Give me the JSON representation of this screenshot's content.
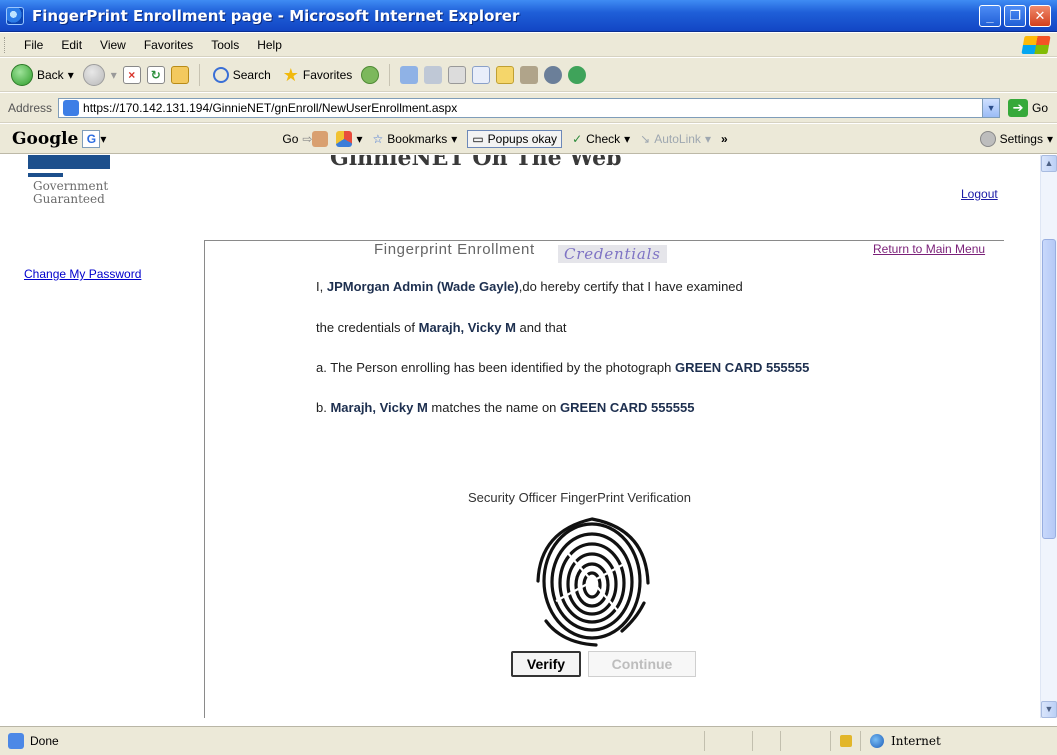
{
  "window": {
    "title": "FingerPrint Enrollment page - Microsoft Internet Explorer"
  },
  "menu": [
    "File",
    "Edit",
    "View",
    "Favorites",
    "Tools",
    "Help"
  ],
  "toolbar": {
    "back_label": "Back",
    "search_label": "Search",
    "favorites_label": "Favorites"
  },
  "address": {
    "label": "Address",
    "url": "https://170.142.131.194/GinnieNET/gnEnroll/NewUserEnrollment.aspx",
    "go_label": "Go"
  },
  "google_toolbar": {
    "logo": "Google",
    "g_button": "G",
    "go_label": "Go",
    "bookmarks_label": "Bookmarks",
    "popups_label": "Popups okay",
    "check_label": "Check",
    "autolink_label": "AutoLink",
    "more_label": "»",
    "settings_label": "Settings"
  },
  "page": {
    "header_text": "GinnieNET On The Web",
    "gov_line1": "Government",
    "gov_line2": "Guaranteed",
    "enroll_title": "Fingerprint Enrollment",
    "logout": "Logout",
    "return_link": "Return to Main Menu",
    "change_password": "Change My Password",
    "credentials_heading": "Credentials",
    "line1_pre": "I, ",
    "line1_name": "JPMorgan Admin (Wade Gayle)",
    "line1_post": ",do hereby certify that I have examined",
    "line2_pre": "the credentials of ",
    "line2_name": "Marajh, Vicky M",
    "line2_post": " and that",
    "line3_pre": "a. The Person enrolling has been identified by the photograph ",
    "line3_doc": "GREEN CARD 555555",
    "line4_pre": "b. ",
    "line4_name": "Marajh, Vicky M",
    "line4_mid": " matches the name on ",
    "line4_doc": "GREEN CARD 555555",
    "security_label": "Security Officer FingerPrint Verification",
    "verify_button": "Verify",
    "continue_button": "Continue"
  },
  "status": {
    "text": "Done",
    "zone": "Internet"
  },
  "colors": {
    "title_blue": "#1f5fd8",
    "chrome": "#ece9d8",
    "link": "#0000cc",
    "credentials": "#7e73c4"
  }
}
